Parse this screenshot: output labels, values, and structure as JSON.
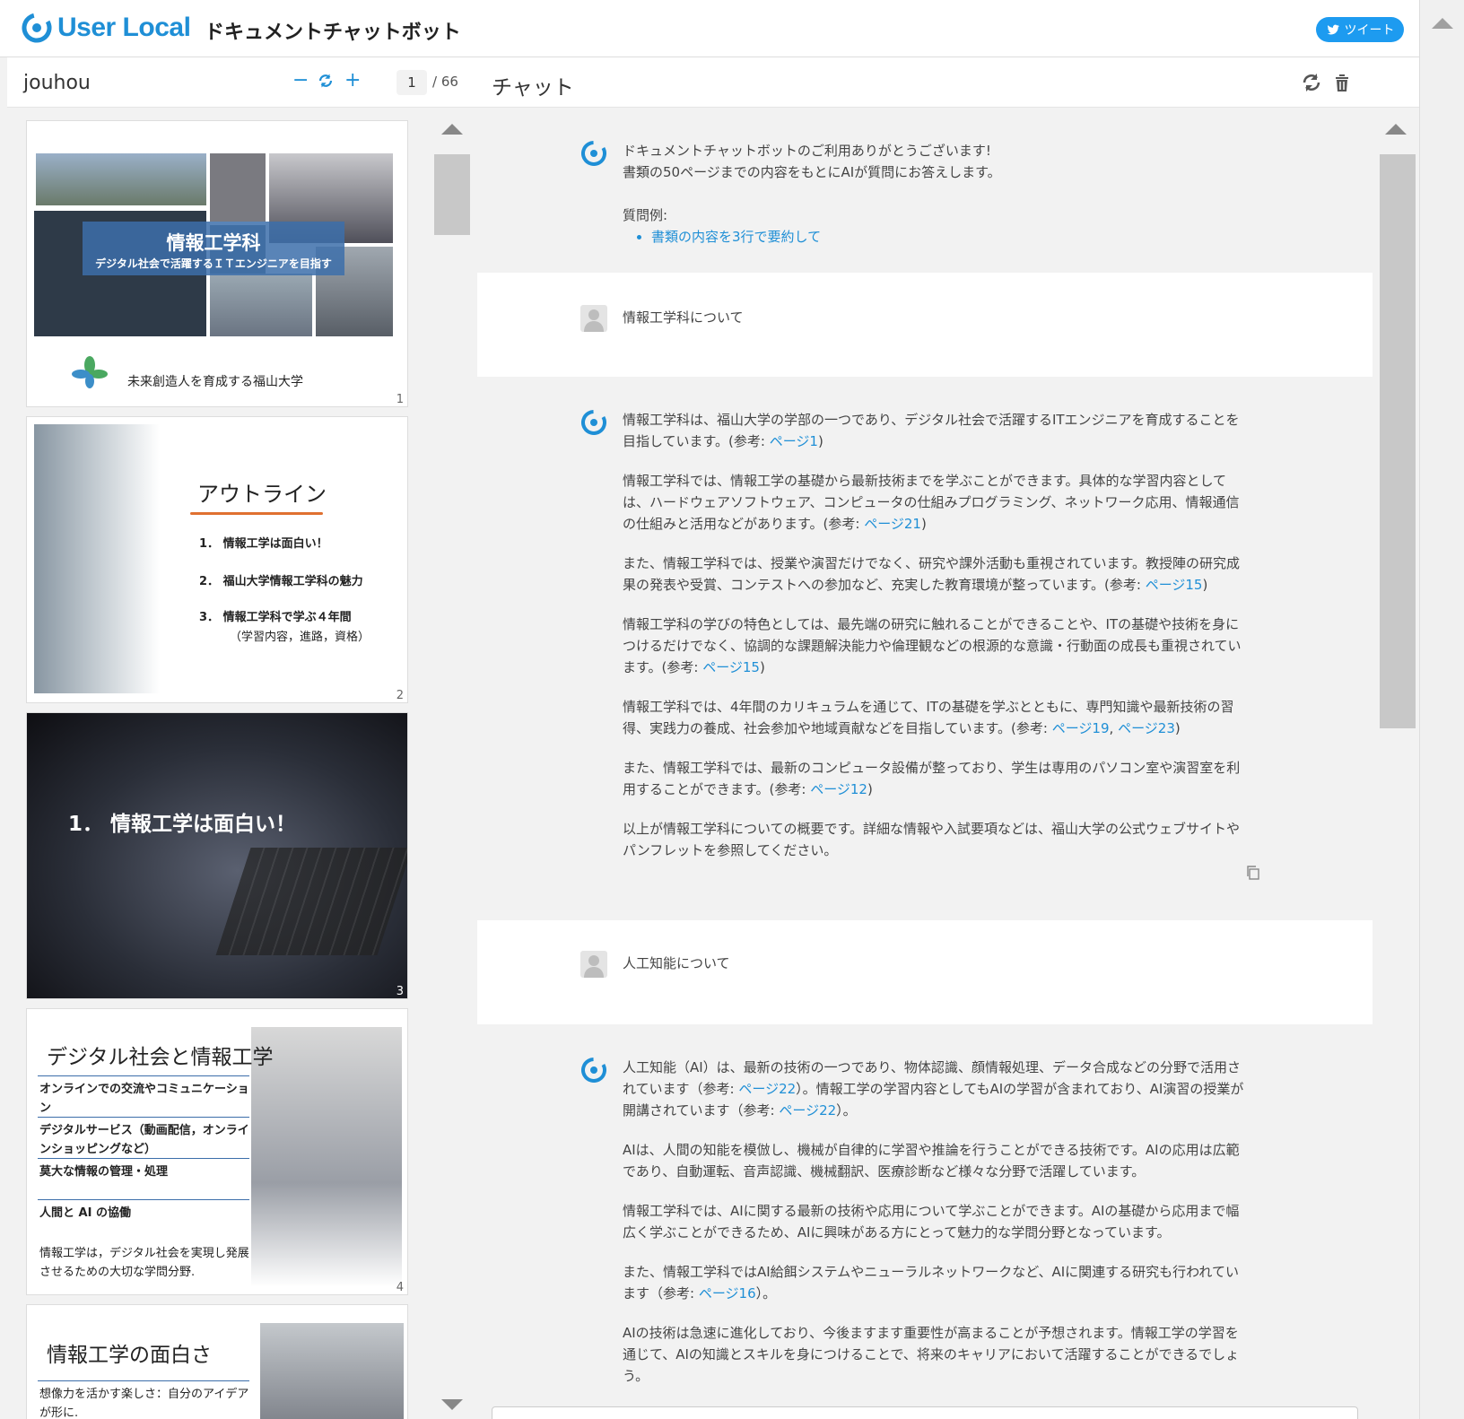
{
  "header": {
    "logo_text": "User Local",
    "app_title": "ドキュメントチャットボット",
    "tweet_label": "ツイート"
  },
  "doc": {
    "name": "jouhou",
    "zoom_out": "−",
    "zoom_reset": "↻",
    "zoom_in": "+",
    "current_page": "1",
    "total_pages": "/ 66",
    "pages": [
      {
        "num": "1",
        "title": "情報工学科",
        "subtitle": "デジタル社会で活躍するＩＴエンジニアを目指す",
        "tagline": "未来創造人を育成する福山大学"
      },
      {
        "num": "2",
        "title": "アウトライン",
        "items": [
          "1． 情報工学は面白い！",
          "2． 福山大学情報工学科の魅力",
          "3． 情報工学科で学ぶ４年間"
        ],
        "sub": "（学習内容，進路，資格）"
      },
      {
        "num": "3",
        "heading": "1． 情報工学は面白い！"
      },
      {
        "num": "4",
        "title": "デジタル社会と情報工学",
        "rows": [
          "オンラインでの交流やコミュニケーション",
          "デジタルサービス（動画配信，オンラインショッピングなど）",
          "莫大な情報の管理・処理",
          "人間と AI の協働"
        ],
        "foot": "情報工学は，デジタル社会を実現し発展させるための大切な学問分野."
      },
      {
        "num": "5",
        "title": "情報工学の面白さ",
        "row": "想像力を活かす楽しさ：自分のアイデアが形に."
      }
    ]
  },
  "chat": {
    "title": "チャット",
    "welcome": {
      "line1": "ドキュメントチャットボットのご利用ありがとうございます!",
      "line2": "書類の50ページまでの内容をもとにAIが質問にお答えします。",
      "examples_label": "質問例:",
      "example1": "書類の内容を3行で要約して"
    },
    "user1": "情報工学科について",
    "bot1": {
      "p1": "情報工学科は、福山大学の学部の一つであり、デジタル社会で活躍するITエンジニアを育成することを目指しています。(参考: ",
      "p1_link": "ページ1",
      "p2": "情報工学科では、情報工学の基礎から最新技術までを学ぶことができます。具体的な学習内容としては、ハードウェアソフトウェア、コンピュータの仕組みプログラミング、ネットワーク応用、情報通信の仕組みと活用などがあります。(参考: ",
      "p2_link": "ページ21",
      "p3": "また、情報工学科では、授業や演習だけでなく、研究や課外活動も重視されています。教授陣の研究成果の発表や受賞、コンテストへの参加など、充実した教育環境が整っています。(参考: ",
      "p3_link": "ページ15",
      "p4": "情報工学科の学びの特色としては、最先端の研究に触れることができることや、ITの基礎や技術を身につけるだけでなく、協調的な課題解決能力や倫理観などの根源的な意識・行動面の成長も重視されています。(参考: ",
      "p4_link": "ページ15",
      "p5": "情報工学科では、4年間のカリキュラムを通じて、ITの基礎を学ぶとともに、専門知識や最新技術の習得、実践力の養成、社会参加や地域貢献などを目指しています。(参考: ",
      "p5_link1": "ページ19",
      "p5_link2": "ページ23",
      "p6": "また、情報工学科では、最新のコンピュータ設備が整っており、学生は専用のパソコン室や演習室を利用することができます。(参考: ",
      "p6_link": "ページ12",
      "p7": "以上が情報工学科についての概要です。詳細な情報や入試要項などは、福山大学の公式ウェブサイトやパンフレットを参照してください。"
    },
    "user2": "人工知能について",
    "bot2": {
      "p1a": "人工知能（AI）は、最新の技術の一つであり、物体認識、顔情報処理、データ合成などの分野で活用されています（参考: ",
      "p1_link1": "ページ22",
      "p1b": "）。情報工学の学習内容としてもAIの学習が含まれており、AI演習の授業が開講されています（参考: ",
      "p1_link2": "ページ22",
      "p1c": "）。",
      "p2": "AIは、人間の知能を模倣し、機械が自律的に学習や推論を行うことができる技術です。AIの応用は広範であり、自動運転、音声認識、機械翻訳、医療診断など様々な分野で活躍しています。",
      "p3": "情報工学科では、AIに関する最新の技術や応用について学ぶことができます。AIの基礎から応用まで幅広く学ぶことができるため、AIに興味がある方にとって魅力的な学問分野となっています。",
      "p4a": "また、情報工学科ではAI給餌システムやニューラルネットワークなど、AIに関連する研究も行われています（参考: ",
      "p4_link": "ページ16",
      "p4b": "）。",
      "p5": "AIの技術は急速に進化しており、今後ますます重要性が高まることが予想されます。情報工学の学習を通じて、AIの知識とスキルを身につけることで、将来のキャリアにおいて活躍することができるでしょう。"
    }
  },
  "colors": {
    "accent": "#1f8fd6",
    "tweet": "#1d9bf0",
    "orange": "#e07030"
  }
}
